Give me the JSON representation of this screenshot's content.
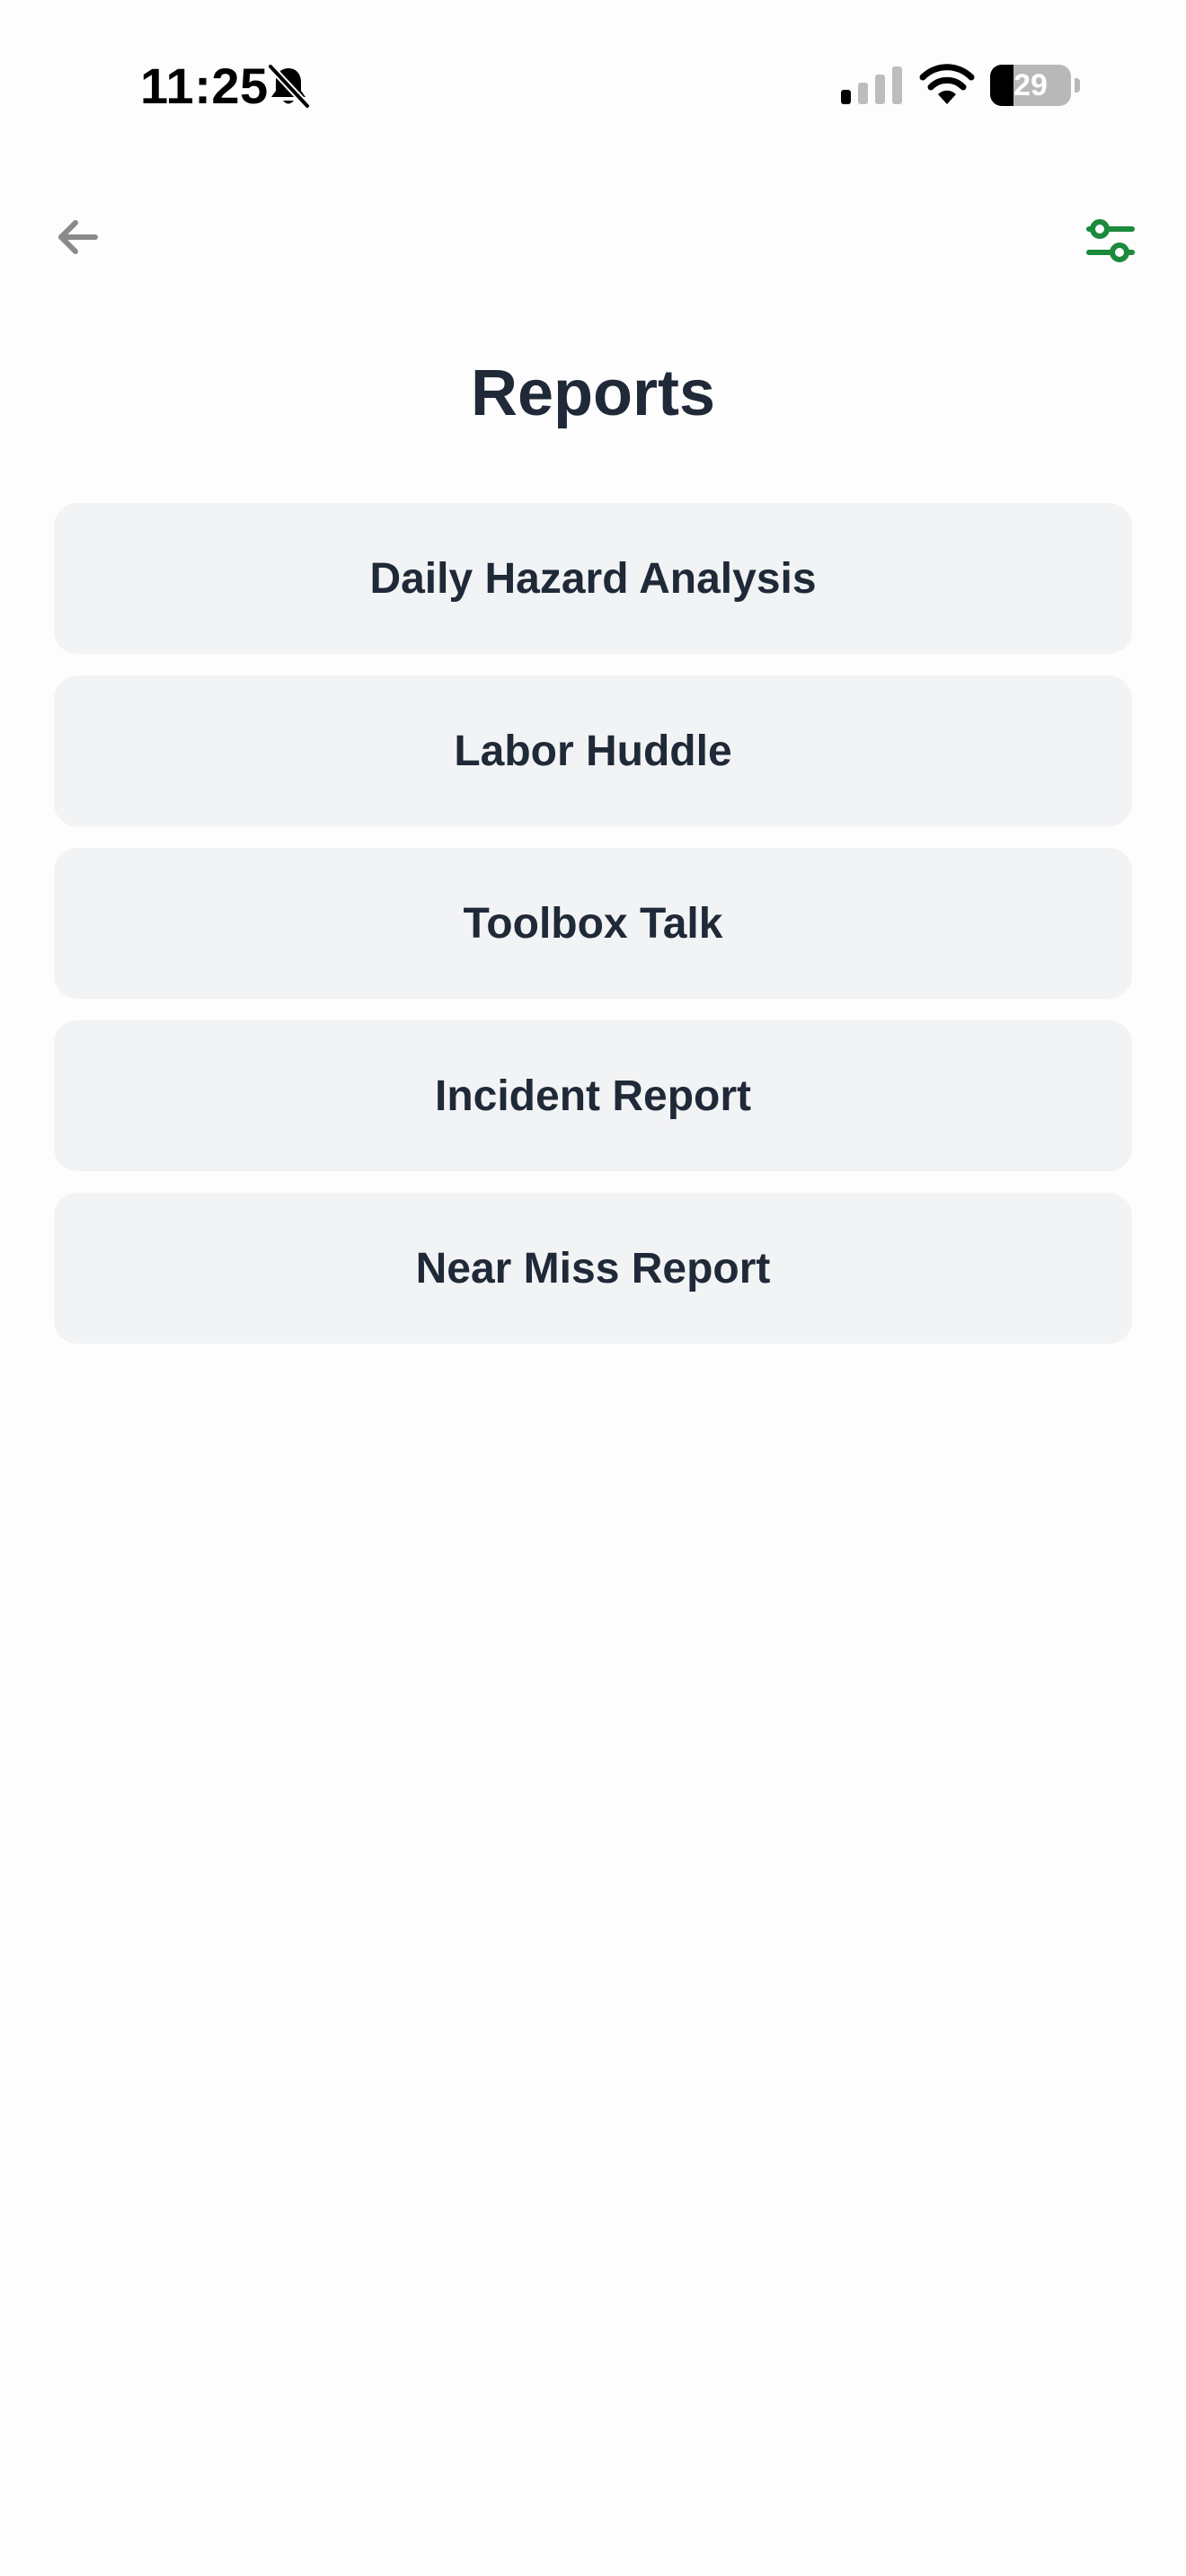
{
  "status_bar": {
    "time": "11:25",
    "battery_level": "29",
    "battery_fraction": 0.29,
    "icons": [
      "bell-slash-icon",
      "cellular-signal-icon",
      "wifi-icon",
      "battery-icon"
    ]
  },
  "nav": {
    "back_icon": "arrow-left-icon",
    "filter_icon": "sliders-icon"
  },
  "page": {
    "title": "Reports"
  },
  "reports": [
    {
      "label": "Daily Hazard Analysis"
    },
    {
      "label": "Labor Huddle"
    },
    {
      "label": "Toolbox Talk"
    },
    {
      "label": "Incident Report"
    },
    {
      "label": "Near Miss Report"
    }
  ],
  "colors": {
    "accent": "#1a8a3c",
    "muted_icon": "#8a8a8a",
    "card_bg": "#f2f3f5",
    "text": "#1f2937"
  }
}
